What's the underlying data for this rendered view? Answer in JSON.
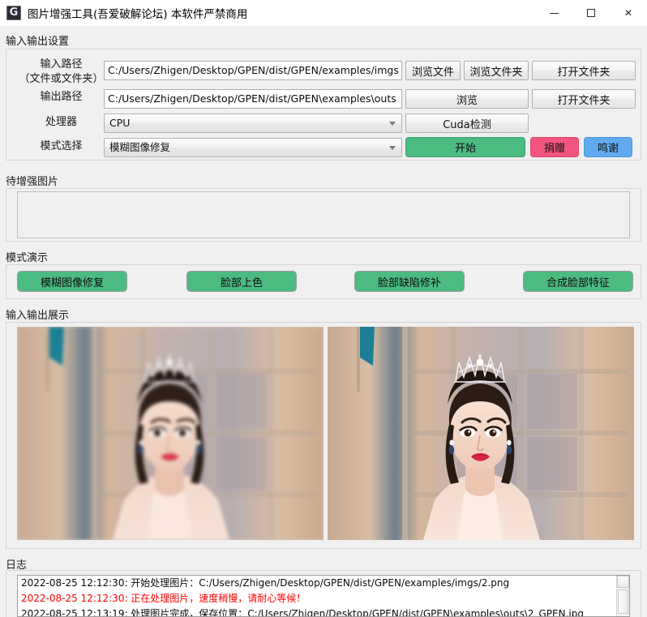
{
  "window": {
    "title": "图片增强工具(吾爱破解论坛) 本软件严禁商用",
    "app_icon": "g-logo-icon",
    "minimize_label": "最小化",
    "maximize_label": "最大化",
    "close_label": "关闭"
  },
  "io_settings": {
    "group_label": "输入输出设置",
    "input_path": {
      "label_line1": "输入路径",
      "label_line2": "（文件或文件夹）",
      "value": "C:/Users/Zhigen/Desktop/GPEN/dist/GPEN/examples/imgs",
      "browse_file": "浏览文件",
      "browse_folder": "浏览文件夹",
      "open_folder": "打开文件夹"
    },
    "output_path": {
      "label": "输出路径",
      "value": "C:/Users/Zhigen/Desktop/GPEN/dist/GPEN\\examples\\outs",
      "browse": "浏览",
      "open_folder": "打开文件夹"
    },
    "processor": {
      "label": "处理器",
      "value": "CPU",
      "cuda_check": "Cuda检测"
    },
    "mode": {
      "label": "模式选择",
      "value": "模糊图像修复"
    },
    "actions": {
      "start": "开始",
      "donate": "捐赠",
      "thanks": "鸣谢"
    }
  },
  "pending": {
    "group_label": "待增强图片",
    "items": []
  },
  "demo": {
    "group_label": "模式演示",
    "buttons": [
      "模糊图像修复",
      "脸部上色",
      "脸部缺陷修补",
      "合成脸部特征"
    ]
  },
  "preview": {
    "group_label": "输入输出展示",
    "input_caption": "",
    "output_caption": ""
  },
  "log": {
    "group_label": "日志",
    "lines": [
      {
        "text": "2022-08-25 12:12:30: 开始处理图片：C:/Users/Zhigen/Desktop/GPEN/dist/GPEN/examples/imgs/2.png",
        "color": "#0a0a0a"
      },
      {
        "text": "2022-08-25 12:12:30: 正在处理图片，速度稍慢，请耐心等候！",
        "color": "#ff0000"
      },
      {
        "text": "2022-08-25 12:13:19: 处理图片完成，保存位置：C:/Users/Zhigen/Desktop/GPEN/dist/GPEN\\examples\\outs\\2_GPEN.jpg",
        "color": "#0a0a0a"
      }
    ]
  },
  "colors": {
    "green": "#4cbb82",
    "pink": "#f2567f",
    "blue": "#60aaf0",
    "window_bg": "#f0f0f0",
    "error_text": "#ff0000"
  }
}
